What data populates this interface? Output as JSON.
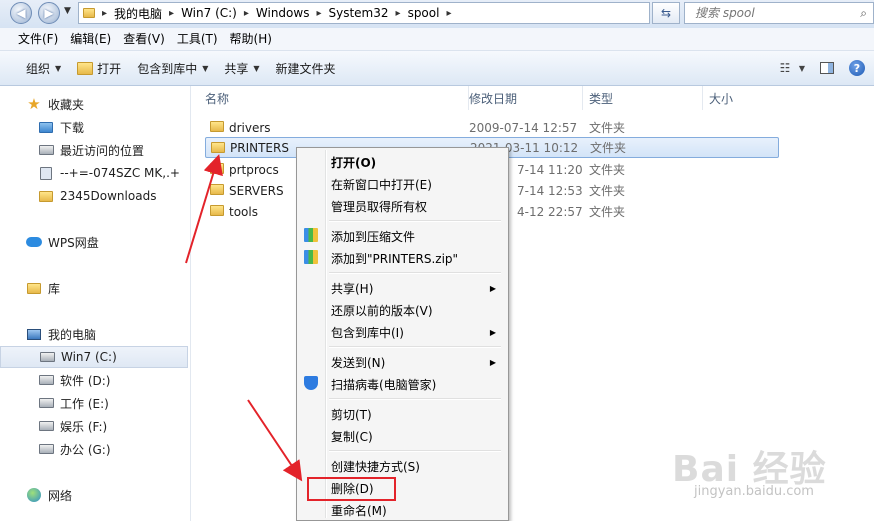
{
  "address": {
    "crumbs": [
      "我的电脑",
      "Win7 (C:)",
      "Windows",
      "System32",
      "spool"
    ],
    "search_placeholder": "搜索 spool"
  },
  "menubar": [
    "文件(F)",
    "编辑(E)",
    "查看(V)",
    "工具(T)",
    "帮助(H)"
  ],
  "commands": {
    "organize": "组织",
    "open": "打开",
    "include": "包含到库中",
    "share": "共享",
    "new_folder": "新建文件夹"
  },
  "sidebar": {
    "favorites": "收藏夹",
    "downloads": "下载",
    "recent": "最近访问的位置",
    "shortcut1": "--+=-074SZC MK,.+",
    "downloads2345": "2345Downloads",
    "wps": "WPS网盘",
    "library": "库",
    "computer": "我的电脑",
    "drive_c": "Win7 (C:)",
    "drive_d": "软件 (D:)",
    "drive_e": "工作 (E:)",
    "drive_f": "娱乐 (F:)",
    "drive_g": "办公 (G:)",
    "network": "网络"
  },
  "columns": {
    "name": "名称",
    "modified": "修改日期",
    "type": "类型",
    "size": "大小"
  },
  "files": [
    {
      "name": "drivers",
      "date": "2009-07-14 12:57",
      "type": "文件夹"
    },
    {
      "name": "PRINTERS",
      "date": "2021-03-11 10:12",
      "type": "文件夹"
    },
    {
      "name": "prtprocs",
      "date": "7-14 11:20",
      "type": "文件夹"
    },
    {
      "name": "SERVERS",
      "date": "7-14 12:53",
      "type": "文件夹"
    },
    {
      "name": "tools",
      "date": "4-12 22:57",
      "type": "文件夹"
    }
  ],
  "context_menu": {
    "open": "打开(O)",
    "open_new_window": "在新窗口中打开(E)",
    "take_ownership": "管理员取得所有权",
    "add_archive": "添加到压缩文件",
    "add_zip": "添加到\"PRINTERS.zip\"",
    "share": "共享(H)",
    "restore": "还原以前的版本(V)",
    "include": "包含到库中(I)",
    "send_to": "发送到(N)",
    "scan": "扫描病毒(电脑管家)",
    "cut": "剪切(T)",
    "copy": "复制(C)",
    "shortcut": "创建快捷方式(S)",
    "delete": "删除(D)",
    "rename": "重命名(M)"
  },
  "accent": {
    "annotation": "#e3232a",
    "selection": "#84acdd"
  }
}
